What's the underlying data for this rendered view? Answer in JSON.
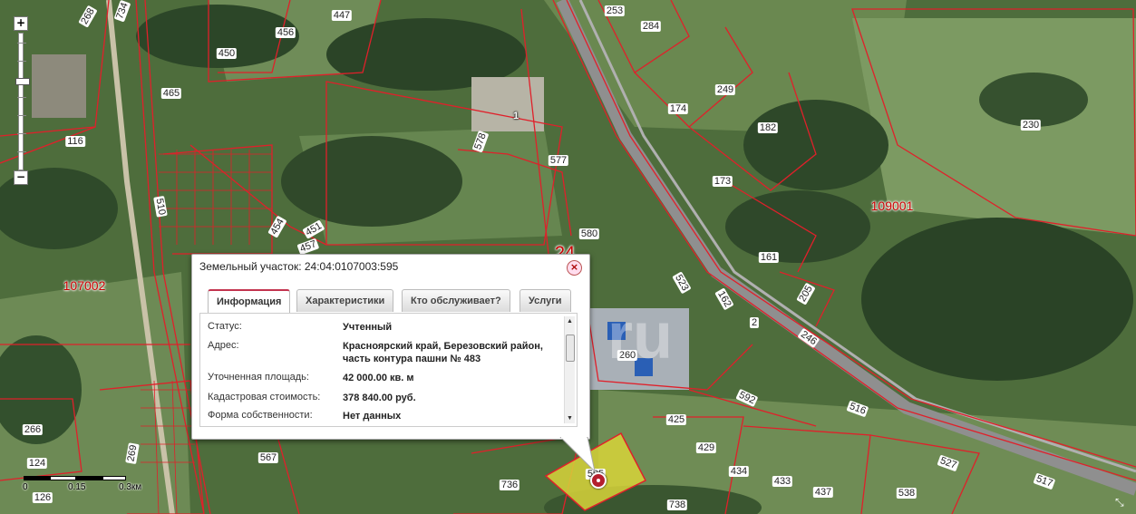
{
  "map": {
    "quarters": [
      {
        "id": "q1",
        "text": "107002"
      },
      {
        "id": "q2",
        "text": "109001"
      },
      {
        "id": "q3",
        "text": "24"
      }
    ],
    "plots": [
      {
        "id": "p268",
        "text": "268"
      },
      {
        "id": "p734",
        "text": "734"
      },
      {
        "id": "p447",
        "text": "447"
      },
      {
        "id": "p456",
        "text": "456"
      },
      {
        "id": "p450",
        "text": "450"
      },
      {
        "id": "p465",
        "text": "465"
      },
      {
        "id": "p116",
        "text": "116"
      },
      {
        "id": "p510",
        "text": "510"
      },
      {
        "id": "p1",
        "text": "1"
      },
      {
        "id": "p578",
        "text": "578"
      },
      {
        "id": "p577",
        "text": "577"
      },
      {
        "id": "p253",
        "text": "253"
      },
      {
        "id": "p284",
        "text": "284"
      },
      {
        "id": "p249",
        "text": "249"
      },
      {
        "id": "p174",
        "text": "174"
      },
      {
        "id": "p182",
        "text": "182"
      },
      {
        "id": "p230",
        "text": "230"
      },
      {
        "id": "p173",
        "text": "173"
      },
      {
        "id": "p451",
        "text": "451"
      },
      {
        "id": "p454",
        "text": "454"
      },
      {
        "id": "p457",
        "text": "457"
      },
      {
        "id": "p580",
        "text": "580"
      },
      {
        "id": "p161",
        "text": "161"
      },
      {
        "id": "p205",
        "text": "205"
      },
      {
        "id": "p523",
        "text": "523"
      },
      {
        "id": "p162",
        "text": "162"
      },
      {
        "id": "p2",
        "text": "2"
      },
      {
        "id": "p246",
        "text": "246"
      },
      {
        "id": "p260",
        "text": "260"
      },
      {
        "id": "p592",
        "text": "592"
      },
      {
        "id": "p516",
        "text": "516"
      },
      {
        "id": "p425",
        "text": "425"
      },
      {
        "id": "p429",
        "text": "429"
      },
      {
        "id": "p434",
        "text": "434"
      },
      {
        "id": "p433",
        "text": "433"
      },
      {
        "id": "p437",
        "text": "437"
      },
      {
        "id": "p538",
        "text": "538"
      },
      {
        "id": "p527",
        "text": "527"
      },
      {
        "id": "p517",
        "text": "517"
      },
      {
        "id": "p738",
        "text": "738"
      },
      {
        "id": "p736",
        "text": "736"
      },
      {
        "id": "p567",
        "text": "567"
      },
      {
        "id": "p266",
        "text": "266"
      },
      {
        "id": "p124",
        "text": "124"
      },
      {
        "id": "p126",
        "text": "126"
      },
      {
        "id": "p269",
        "text": "269"
      },
      {
        "id": "p595",
        "text": "595"
      }
    ],
    "watermark": "ru",
    "scale": {
      "labels": [
        "0",
        "0.15",
        "0.3км"
      ]
    },
    "zoom": {
      "plus": "+",
      "minus": "−",
      "level_fraction": 0.66
    }
  },
  "popup": {
    "title": "Земельный участок: 24:04:0107003:595",
    "close": "×",
    "tabs": [
      {
        "label": "Информация",
        "active": true
      },
      {
        "label": "Характеристики",
        "active": false
      },
      {
        "label": "Кто обслуживает?",
        "active": false
      },
      {
        "label": "Услуги",
        "active": false
      }
    ],
    "rows": [
      {
        "key": "Статус:",
        "value": "Учтенный"
      },
      {
        "key": "Адрес:",
        "value": "Красноярский край, Березовский район, часть контура пашни № 483"
      },
      {
        "key": "Уточненная площадь:",
        "value": "42 000.00 кв. м"
      },
      {
        "key": "Кадастровая стоимость:",
        "value": "378 840.00 руб."
      },
      {
        "key": "Форма собственности:",
        "value": "Нет данных"
      }
    ],
    "scroll_up": "▲",
    "scroll_down": "▼"
  },
  "colors": {
    "boundary": "#e0202a",
    "selected_fill": "#d8d43a"
  }
}
